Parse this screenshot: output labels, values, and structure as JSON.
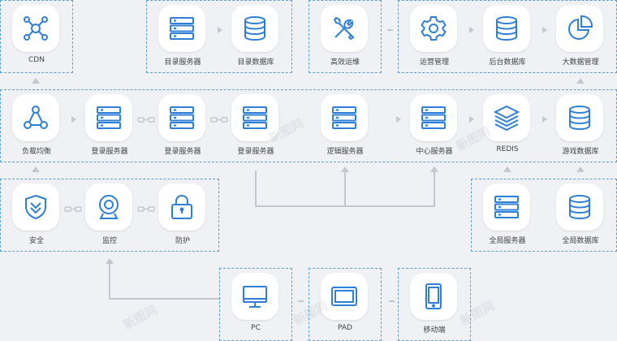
{
  "nodes": {
    "cdn": "CDN",
    "dir_server": "目录服务器",
    "dir_db": "目录数据库",
    "ops": "高效运维",
    "op_mgmt": "运营管理",
    "backend_db": "后台数据库",
    "bigdata": "大数据管理",
    "lb": "负载均衡",
    "login1": "登录服务器",
    "login2": "登录服务器",
    "login3": "登录服务器",
    "logic": "逻辑服务器",
    "center": "中心服务器",
    "redis": "REDIS",
    "game_db": "游戏数据库",
    "security": "安全",
    "monitor": "监控",
    "protect": "防护",
    "global_server": "全局服务器",
    "global_db": "全局数据库",
    "pc": "PC",
    "pad": "PAD",
    "mobile": "移动端"
  },
  "watermark": "新图网",
  "colors": {
    "accent": "#2f7fd6",
    "dashed_border": "#5a9fd6",
    "background": "#f0f1f4",
    "connector": "#c3c7ce"
  }
}
